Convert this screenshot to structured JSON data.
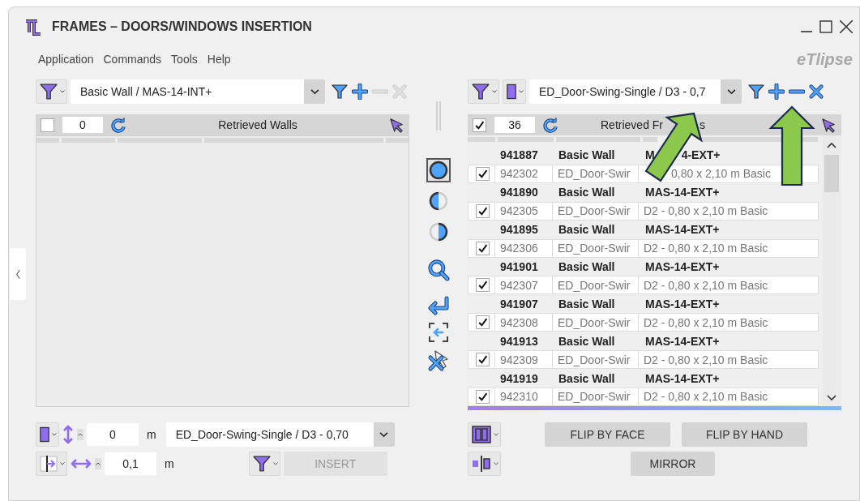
{
  "window": {
    "title": "FRAMES – DOORS/WINDOWS INSERTION"
  },
  "menu": [
    "Application",
    "Commands",
    "Tools",
    "Help"
  ],
  "brand": "eTlipse",
  "left_panel": {
    "combo_value": "Basic Wall / MAS-14-INT+",
    "remove_enabled": false,
    "header": {
      "checked": false,
      "count": "0",
      "title_parts": [
        "Retrieved Walls"
      ]
    }
  },
  "placement_modes": [
    {
      "selected": true
    },
    {
      "selected": false
    },
    {
      "selected": false
    }
  ],
  "right_panel": {
    "combo_value": "ED_Door-Swing-Single / D3 - 0,7",
    "remove_enabled": true,
    "header": {
      "checked": true,
      "count": "36",
      "title_parts": [
        "Retrieved Fr",
        "s"
      ]
    },
    "rows": [
      {
        "wall_id": "941887",
        "wall_family": "Basic Wall",
        "wall_type_parts": [
          "M",
          "4-EXT+"
        ],
        "checked": true,
        "frame_id": "942302",
        "frame_family": "ED_Door-Swir",
        "frame_type_parts": [
          "0,80 x 2,10 m Basic"
        ],
        "arrow_over_type": true
      },
      {
        "wall_id": "941890",
        "wall_family": "Basic Wall",
        "wall_type_parts": [
          "MAS-14-EXT+"
        ],
        "checked": true,
        "frame_id": "942305",
        "frame_family": "ED_Door-Swir",
        "frame_type_parts": [
          "D2 - 0,80 x 2,10 m Basic"
        ]
      },
      {
        "wall_id": "941895",
        "wall_family": "Basic Wall",
        "wall_type_parts": [
          "MAS-14-EXT+"
        ],
        "checked": true,
        "frame_id": "942306",
        "frame_family": "ED_Door-Swir",
        "frame_type_parts": [
          "D2 - 0,80 x 2,10 m Basic"
        ]
      },
      {
        "wall_id": "941901",
        "wall_family": "Basic Wall",
        "wall_type_parts": [
          "MAS-14-EXT+"
        ],
        "checked": true,
        "frame_id": "942307",
        "frame_family": "ED_Door-Swir",
        "frame_type_parts": [
          "D2 - 0,80 x 2,10 m Basic"
        ]
      },
      {
        "wall_id": "941907",
        "wall_family": "Basic Wall",
        "wall_type_parts": [
          "MAS-14-EXT+"
        ],
        "checked": true,
        "frame_id": "942308",
        "frame_family": "ED_Door-Swir",
        "frame_type_parts": [
          "D2 - 0,80 x 2,10 m Basic"
        ]
      },
      {
        "wall_id": "941913",
        "wall_family": "Basic Wall",
        "wall_type_parts": [
          "MAS-14-EXT+"
        ],
        "checked": true,
        "frame_id": "942309",
        "frame_family": "ED_Door-Swir",
        "frame_type_parts": [
          "D2 - 0,80 x 2,10 m Basic"
        ]
      },
      {
        "wall_id": "941919",
        "wall_family": "Basic Wall",
        "wall_type_parts": [
          "MAS-14-EXT+"
        ],
        "checked": true,
        "frame_id": "942310",
        "frame_family": "ED_Door-Swir",
        "frame_type_parts": [
          "D2 - 0,80 x 2,10 m Basic"
        ]
      }
    ]
  },
  "bottom_left": {
    "height": {
      "value": "0",
      "unit": "m"
    },
    "offset": {
      "value": "0,1",
      "unit": "m"
    },
    "type_combo": "ED_Door-Swing-Single / D3 - 0,70",
    "insert": {
      "label": "INSERT",
      "disabled": true
    }
  },
  "bottom_right": {
    "flip_buttons": [
      "FLIP BY FACE",
      "FLIP BY HAND"
    ],
    "mirror": "MIRROR"
  }
}
